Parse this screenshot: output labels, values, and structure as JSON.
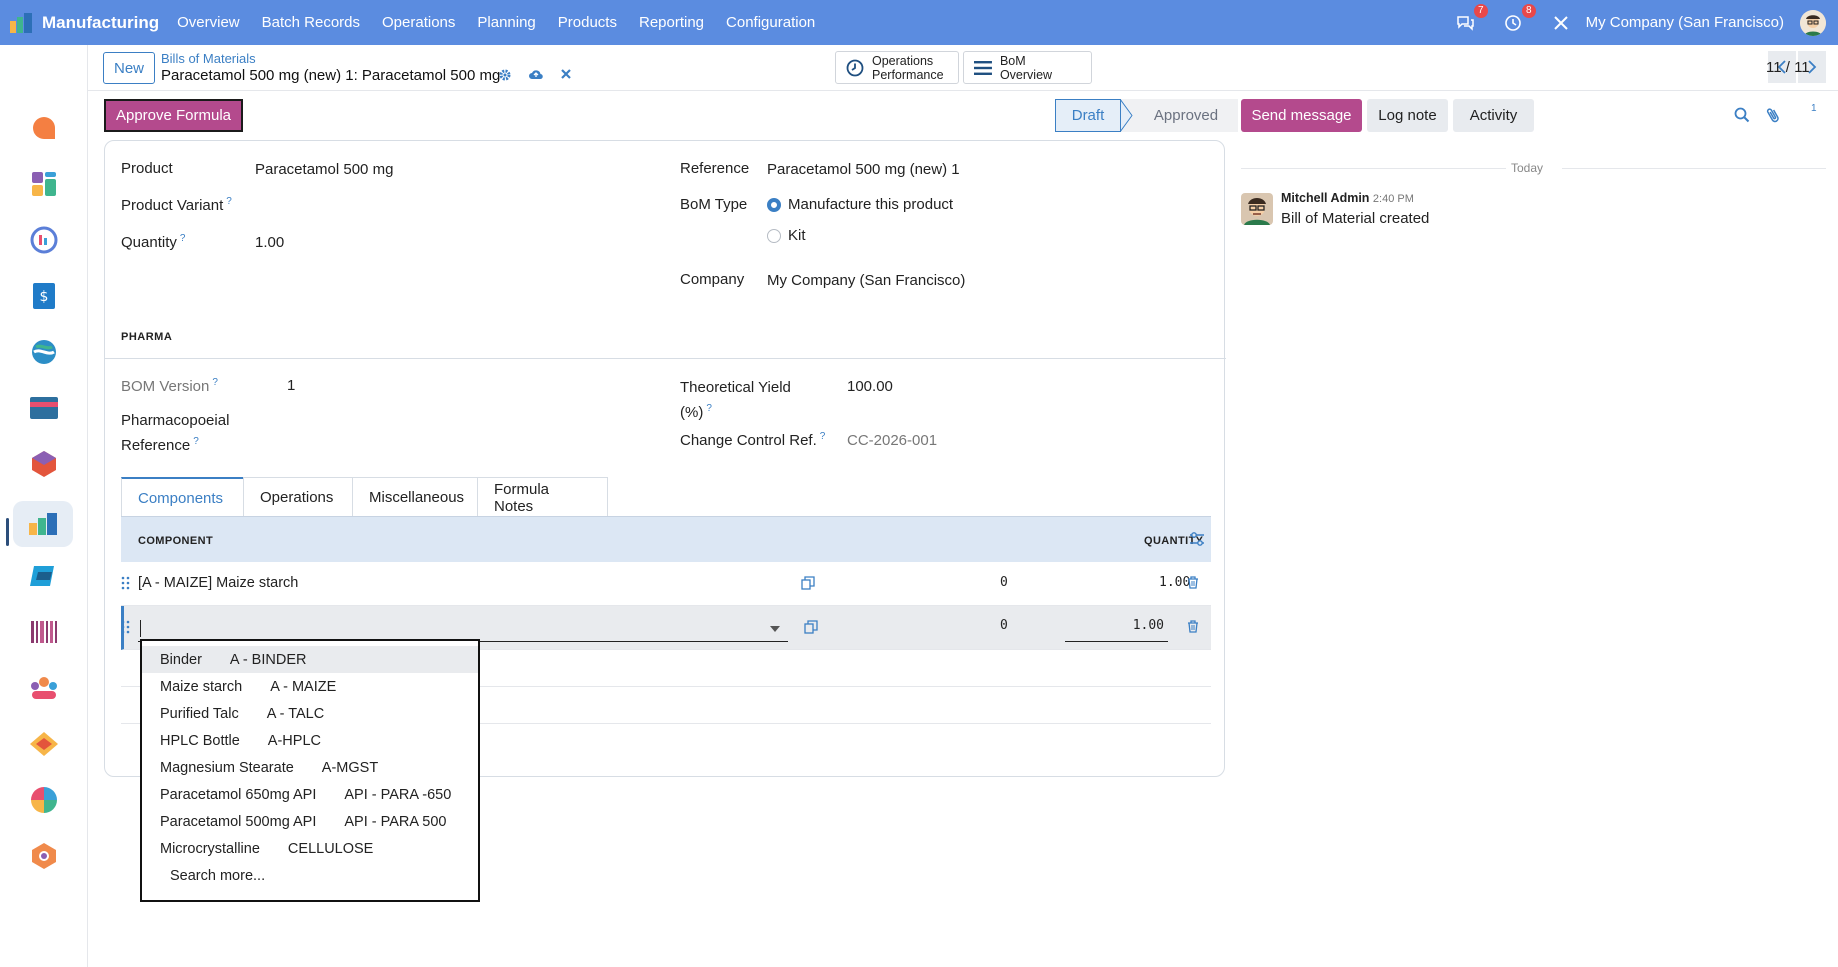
{
  "topbar": {
    "app_name": "Manufacturing",
    "menu": [
      "Overview",
      "Batch Records",
      "Operations",
      "Planning",
      "Products",
      "Reporting",
      "Configuration"
    ],
    "messages_count": "7",
    "activities_count": "8",
    "company": "My Company (San Francisco)"
  },
  "sidebar": {
    "apps": [
      "discuss-icon",
      "dashboards-icon",
      "studio-icon",
      "accounting-icon",
      "documents-icon",
      "card-icon",
      "inventory-icon",
      "manufacturing-icon",
      "quality-icon",
      "barcode-icon",
      "employees-icon",
      "sign-icon",
      "analytics-icon",
      "settings-icon"
    ],
    "active_index": 7
  },
  "control_panel": {
    "new_label": "New",
    "breadcrumb_parent": "Bills of Materials",
    "breadcrumb_current": "Paracetamol 500 mg (new) 1: Paracetamol 500 mg",
    "ops_perf_line1": "Operations",
    "ops_perf_line2": "Performance",
    "bom_overview": "BoM Overview",
    "pager": "11 / 11"
  },
  "statusbar": {
    "approve_label": "Approve Formula",
    "stages": [
      "Draft",
      "Approved"
    ],
    "current": "Draft"
  },
  "form": {
    "product_label": "Product",
    "product_value": "Paracetamol 500 mg",
    "variant_label": "Product Variant",
    "quantity_label": "Quantity",
    "quantity_value": "1.00",
    "reference_label": "Reference",
    "reference_value": "Paracetamol 500 mg (new) 1",
    "bom_type_label": "BoM Type",
    "bom_type_options": [
      "Manufacture this product",
      "Kit"
    ],
    "bom_type_selected": "Manufacture this product",
    "company_label": "Company",
    "company_value": "My Company (San Francisco)",
    "pharma_section": "PHARMA",
    "bom_version_label": "BOM Version",
    "bom_version_value": "1",
    "pharmaco_label_1": "Pharmacopoeial",
    "pharmaco_label_2": "Reference",
    "yield_label_1": "Theoretical Yield",
    "yield_label_2": "(%)",
    "yield_value": "100.00",
    "change_ref_label": "Change Control Ref.",
    "change_ref_placeholder": "CC-2026-001"
  },
  "tabs": [
    "Components",
    "Operations",
    "Miscellaneous",
    "Formula Notes"
  ],
  "components_table": {
    "headers": {
      "component": "COMPONENT",
      "quantity": "QUANTITY"
    },
    "rows": [
      {
        "component": "[A - MAIZE] Maize starch",
        "num": "0",
        "quantity": "1.00"
      },
      {
        "component": "",
        "num": "0",
        "quantity": "1.00"
      }
    ]
  },
  "dropdown": {
    "items": [
      {
        "name": "Binder",
        "code": "A - BINDER"
      },
      {
        "name": "Maize starch",
        "code": "A - MAIZE"
      },
      {
        "name": "Purified Talc",
        "code": "A - TALC"
      },
      {
        "name": "HPLC Bottle",
        "code": "A-HPLC"
      },
      {
        "name": "Magnesium Stearate",
        "code": "A-MGST"
      },
      {
        "name": "Paracetamol 650mg API",
        "code": "API - PARA -650"
      },
      {
        "name": "Paracetamol 500mg API",
        "code": "API - PARA 500"
      },
      {
        "name": "Microcrystalline",
        "code": "CELLULOSE"
      }
    ],
    "search_more": "Search more..."
  },
  "chatter": {
    "send_message": "Send message",
    "log_note": "Log note",
    "activity": "Activity",
    "followers_count": "1",
    "date_separator": "Today",
    "message_author": "Mitchell Admin",
    "message_time": "2:40 PM",
    "message_body": "Bill of Material created"
  },
  "colors": {
    "topbar": "#5b8ce0",
    "primary": "#b44a8d",
    "accent": "#3b7fc4"
  }
}
